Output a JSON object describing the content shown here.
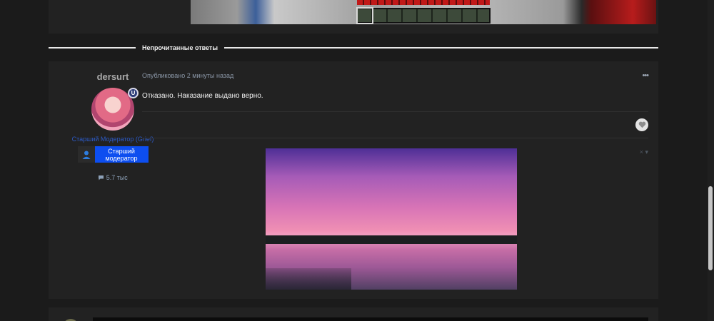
{
  "divider": {
    "label": "Непрочитанные ответы"
  },
  "author": {
    "username": "dersurt",
    "badge": "U",
    "group_title": "Старший Модератор (Grief)",
    "rank_label": "Старший модератор",
    "post_count": "5.7 тыс"
  },
  "post": {
    "meta": "Опубликовано 2 минуты назад",
    "menu": "•••",
    "text": "Отказано. Наказание выдано верно.",
    "close": "× ▾"
  },
  "icons": {
    "badge": "shield-badge-icon",
    "rank": "user-icon",
    "comment": "speech-bubble-icon",
    "like": "heart-icon"
  },
  "colors": {
    "group_title": "#2c5ac6",
    "rank_bg": "#0d4ef0",
    "meta": "#8a96a6"
  }
}
